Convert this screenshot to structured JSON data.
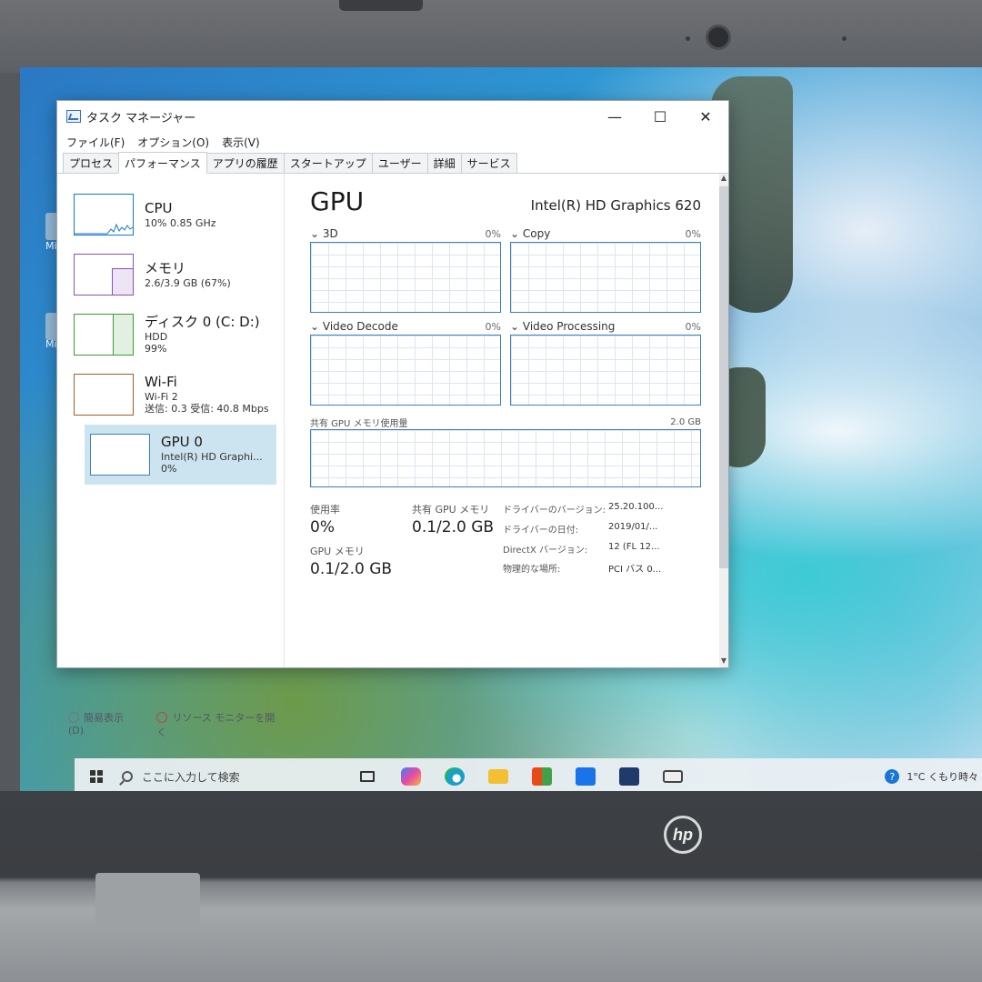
{
  "window": {
    "title": "タスク マネージャー",
    "controls": {
      "minimize": "—",
      "maximize": "☐",
      "close": "✕"
    }
  },
  "menu": [
    "ファイル(F)",
    "オプション(O)",
    "表示(V)"
  ],
  "tabs": [
    {
      "label": "プロセス",
      "active": false
    },
    {
      "label": "パフォーマンス",
      "active": true
    },
    {
      "label": "アプリの履歴",
      "active": false
    },
    {
      "label": "スタートアップ",
      "active": false
    },
    {
      "label": "ユーザー",
      "active": false
    },
    {
      "label": "詳細",
      "active": false
    },
    {
      "label": "サービス",
      "active": false
    }
  ],
  "sidebar": {
    "items": [
      {
        "name": "CPU",
        "line1": "10%  0.85 GHz",
        "line2": ""
      },
      {
        "name": "メモリ",
        "line1": "2.6/3.9 GB (67%)",
        "line2": ""
      },
      {
        "name": "ディスク 0 (C: D:)",
        "line1": "HDD",
        "line2": "99%"
      },
      {
        "name": "Wi-Fi",
        "line1": "Wi-Fi 2",
        "line2": "送信: 0.3  受信: 40.8 Mbps"
      },
      {
        "name": "GPU 0",
        "line1": "Intel(R) HD Graphi...",
        "line2": "0%"
      }
    ],
    "levels": {
      "memory": 0.67,
      "disk": 0.99
    }
  },
  "footer": {
    "fewer_details": "簡易表示(D)",
    "resource_monitor": "リソース モニターを開く"
  },
  "main": {
    "title": "GPU",
    "model": "Intel(R) HD Graphics 620",
    "engines": [
      {
        "name": "3D",
        "percent": "0%"
      },
      {
        "name": "Copy",
        "percent": "0%"
      },
      {
        "name": "Video Decode",
        "percent": "0%"
      },
      {
        "name": "Video Processing",
        "percent": "0%"
      }
    ],
    "shared_memory": {
      "label": "共有 GPU メモリ使用量",
      "max": "2.0 GB"
    },
    "stats": {
      "utilization_label": "使用率",
      "utilization_value": "0%",
      "gpu_memory_label": "GPU メモリ",
      "gpu_memory_value": "0.1/2.0 GB",
      "shared_label": "共有 GPU メモリ",
      "shared_value": "0.1/2.0 GB"
    },
    "info": [
      {
        "label": "ドライバーのバージョン:",
        "value": "25.20.100..."
      },
      {
        "label": "ドライバーの日付:",
        "value": "2019/01/..."
      },
      {
        "label": "DirectX バージョン:",
        "value": "12 (FL 12..."
      },
      {
        "label": "物理的な場所:",
        "value": "PCI バス 0..."
      }
    ]
  },
  "taskbar": {
    "search_placeholder": "ここに入力して検索",
    "weather": "1°C  くもり時々"
  },
  "desktop": {
    "icon_label": "Mic"
  },
  "brand": "hp",
  "colors": {
    "cpu": "#1579c6",
    "memory": "#8a4fb8",
    "disk": "#3c9b36",
    "wifi": "#a35d2a",
    "gpu": "#3d7fc1",
    "selected": "#cce4f0"
  }
}
